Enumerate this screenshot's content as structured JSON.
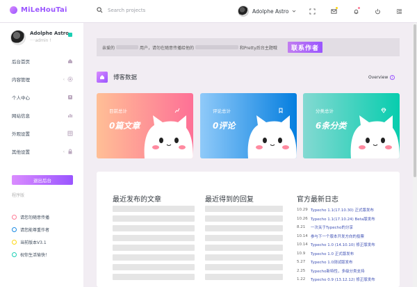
{
  "app": {
    "logo": "MiLeHouTai"
  },
  "topbar": {
    "search_placeholder": "Search projects",
    "profile_name": "Adolphe Astro"
  },
  "sidebar": {
    "user_name": "Adolphe Astro",
    "user_sub": "····admin !",
    "items": [
      {
        "label": "后台首页",
        "icon": "home-icon"
      },
      {
        "label": "内容管理",
        "icon": "settings-icon",
        "arrow": "‹"
      },
      {
        "label": "个人中心",
        "icon": "contacts-icon"
      },
      {
        "label": "网站信息",
        "icon": "chart-icon"
      },
      {
        "label": "外观设置",
        "icon": "table-icon"
      },
      {
        "label": "其他设置",
        "icon": "lock-icon",
        "arrow": "‹"
      }
    ],
    "logout_label": "退出后台",
    "section_label": "程序版",
    "notes": [
      {
        "text": "请您勿随意传播",
        "color": "#fe7c96"
      },
      {
        "text": "请您能尊重作者",
        "color": "#198ae3"
      },
      {
        "text": "当前版本V3.1",
        "color": "#fed713"
      },
      {
        "text": "祝你生活愉快！",
        "color": "#1bcfb4"
      }
    ]
  },
  "notice": {
    "text_a": "亲爱的",
    "text_b": "用户，请勿在随意传播给他的",
    "text_c": "和Pretty后台主题哦",
    "button": "联系作者"
  },
  "blog": {
    "title": "博客数据",
    "overview": "Overview"
  },
  "cards": [
    {
      "label": "目前总计",
      "value": "0篇文章",
      "from": "#ffbf96",
      "to": "#fe7096",
      "icon": "chart-line-icon"
    },
    {
      "label": "评论总计",
      "value": "0评论",
      "from": "#90caf9",
      "to": "#047edf",
      "icon": "bookmark-icon"
    },
    {
      "label": "分类总计",
      "value": "6条分类",
      "from": "#84d9d2",
      "to": "#07cdae",
      "icon": "diamond-icon"
    }
  ],
  "panel": {
    "col1_title": "最近发布的文章",
    "col2_title": "最近得到的回复",
    "col3_title": "官方最新日志",
    "log": [
      {
        "date": "10.29",
        "text": "Typecho 1.1(17.10.30) 正式版发布"
      },
      {
        "date": "10.26",
        "text": "Typecho 1.1(17.10.24) Beta版发布"
      },
      {
        "date": "8.21",
        "text": "一次关于Typecho的分享"
      },
      {
        "date": "10.14",
        "text": "参与下一个版本开发方向的投票"
      },
      {
        "date": "10.14",
        "text": "Typecho 1.0 (14.10.10) 修正版发布"
      },
      {
        "date": "10.9",
        "text": "Typecho 1.0 正式版发布"
      },
      {
        "date": "5.27",
        "text": "Typecho 1.0测试版发布"
      },
      {
        "date": "2.25",
        "text": "Typecho新特性，多级分类支持"
      },
      {
        "date": "1.22",
        "text": "Typecho 0.9 (13.12.12) 修正版发布"
      }
    ]
  }
}
